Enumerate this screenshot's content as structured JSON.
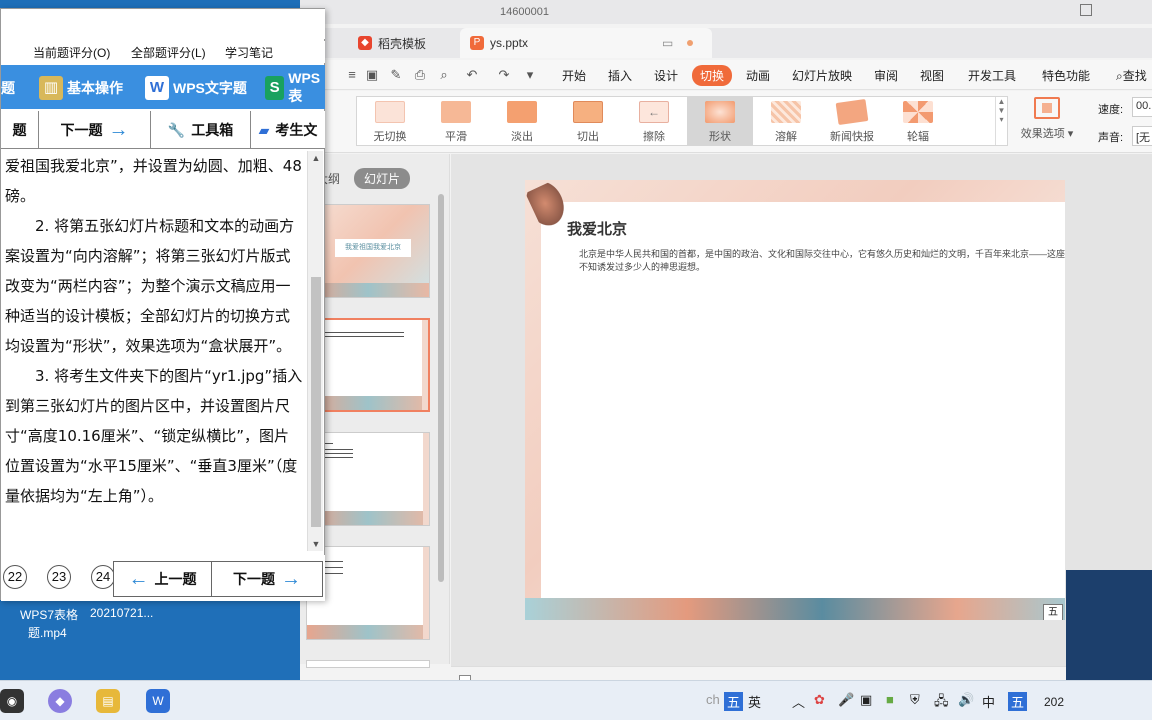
{
  "wps": {
    "title_partial": "14600001",
    "tabs": [
      {
        "label": "稻壳模板",
        "icon": "docer-icon"
      },
      {
        "label": "ys.pptx",
        "icon": "pptx-icon"
      }
    ],
    "menus": [
      "开始",
      "插入",
      "设计",
      "切换",
      "动画",
      "幻灯片放映",
      "审阅",
      "视图",
      "开发工具",
      "特色功能"
    ],
    "active_menu": "切换",
    "search_label": "查找",
    "transitions": [
      "无切换",
      "平滑",
      "淡出",
      "切出",
      "擦除",
      "形状",
      "溶解",
      "新闻快报",
      "轮辐"
    ],
    "selected_transition": "形状",
    "effect_options_label": "效果选项",
    "speed_label": "速度:",
    "speed_value": "00.",
    "sound_label": "声音:",
    "sound_value": "[无",
    "panel_tabs": [
      "大纲",
      "幻灯片"
    ],
    "active_panel_tab": "幻灯片",
    "thumb1_title": "我爱祖国我爱北京",
    "slide": {
      "title": "我爱北京",
      "body": "北京是中华人民共和国的首都，是中国的政治、文化和国际交往中心，它有悠久历史和灿烂的文明，千百年来北京——这座文明古都不知诱发过多少人的神思遐想。",
      "badge": "五"
    }
  },
  "exam": {
    "menu": [
      "当前题评分(O)",
      "全部题评分(L)",
      "学习笔记"
    ],
    "tools": [
      "题",
      "基本操作",
      "WPS文字题",
      "WPS表"
    ],
    "nav": [
      "题",
      "下一题",
      "工具箱",
      "考生文"
    ],
    "text": [
      "爱祖国我爱北京”，并设置为幼圆、加粗、48磅。",
      "　　2. 将第五张幻灯片标题和文本的动画方案设置为“向内溶解”；将第三张幻灯片版式改变为“两栏内容”；为整个演示文稿应用一种适当的设计模板；全部幻灯片的切换方式均设置为“形状”，效果选项为“盒状展开”。",
      "　　3. 将考生文件夹下的图片“yr1.jpg”插入到第三张幻灯片的图片区中，并设置图片尺寸“高度10.16厘米”、“锁定纵横比”，图片位置设置为“水平15厘米”、“垂直3厘米”（度量依据均为“左上角”）。"
    ],
    "question_numbers": [
      "22",
      "23",
      "24"
    ],
    "prev_label": "上一题",
    "next_label": "下一题"
  },
  "desktop": {
    "label1": "WPS7表格",
    "label2": "20210721...",
    "label3": "题.mp4"
  },
  "taskbar": {
    "ime1": "五",
    "ime2": "英",
    "ime3": "中",
    "ime4": "五",
    "clock": "202"
  }
}
